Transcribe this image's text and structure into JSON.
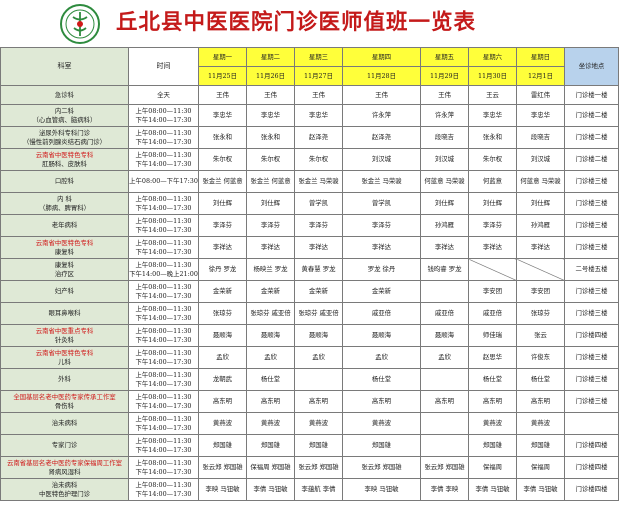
{
  "title": "丘北县中医医院门诊医师值班一览表",
  "header": {
    "dept_label": "科室",
    "time_label": "时间",
    "weekdays": [
      "星期一",
      "星期二",
      "星期三",
      "星期四",
      "星期五",
      "星期六",
      "星期日"
    ],
    "dates": [
      "11月25日",
      "11月26日",
      "11月27日",
      "11月28日",
      "11月29日",
      "11月30日",
      "12月1日"
    ],
    "location_label": "坐诊地点"
  },
  "rows": [
    {
      "dept": [
        "急诊科"
      ],
      "time": [
        "全天"
      ],
      "docs": [
        "王伟",
        "王伟",
        "王伟",
        "王伟",
        "王伟",
        "王云",
        "雷红伟"
      ],
      "loc": "门诊楼一楼"
    },
    {
      "dept": [
        "内二科",
        "（心血管病、脑病科）"
      ],
      "time": [
        "上午08:00—11:30",
        "下午14:00—17:30"
      ],
      "docs": [
        "李忠华",
        "李忠华",
        "李忠华",
        "许永萍",
        "许永萍",
        "李忠华",
        "李忠华"
      ],
      "loc": "门诊楼二楼"
    },
    {
      "dept": [
        "泌尿外科专科门诊",
        "（慢性前列腺炎结石病门诊）"
      ],
      "time": [
        "上午08:00—11:30",
        "下午14:00—17:30"
      ],
      "docs": [
        "张永和",
        "张永和",
        "赵泽尧",
        "赵泽尧",
        "段晓吉",
        "张永和",
        "段晓吉"
      ],
      "loc": "门诊楼二楼"
    },
    {
      "dept": [
        "云南省中医特色专科",
        "肛肠科、皮肤科"
      ],
      "red": [
        true,
        false
      ],
      "time": [
        "上午08:00—11:30",
        "下午14:00—17:30"
      ],
      "docs": [
        "朱尔权",
        "朱尔权",
        "朱尔权",
        "刘汉城",
        "刘汉城",
        "朱尔权",
        "刘汉城"
      ],
      "loc": "门诊楼二楼"
    },
    {
      "dept": [
        "口腔科"
      ],
      "time": [
        "上午08:00—下午17:30"
      ],
      "docs": [
        "张金兰 何蓝意",
        "张金兰 何蓝意",
        "张金兰 马荣骏",
        "张金兰 马荣骏",
        "何蓝意 马荣骏",
        "何蓝意",
        "何蓝意 马荣骏"
      ],
      "loc": "门诊楼三楼"
    },
    {
      "dept": [
        "内 科",
        "（肺病、脾胃科）"
      ],
      "time": [
        "上午08:00—11:30",
        "下午14:00—17:30"
      ],
      "docs": [
        "刘仕辉",
        "刘仕辉",
        "曾学凯",
        "曾学凯",
        "刘仕辉",
        "刘仕辉",
        "刘仕辉"
      ],
      "loc": "门诊楼三楼"
    },
    {
      "dept": [
        "老年病科"
      ],
      "time": [
        "上午08:00—11:30",
        "下午14:00—17:30"
      ],
      "docs": [
        "李泽芬",
        "李泽芬",
        "李泽芬",
        "李泽芬",
        "孙鸿雁",
        "李泽芬",
        "孙鸿雁"
      ],
      "loc": "门诊楼三楼"
    },
    {
      "dept": [
        "云南省中医特色专科",
        "康复科"
      ],
      "red": [
        true,
        false
      ],
      "time": [
        "上午08:00—11:30",
        "下午14:00—17:30"
      ],
      "docs": [
        "李祥达",
        "李祥达",
        "李祥达",
        "李祥达",
        "李祥达",
        "李祥达",
        "李祥达"
      ],
      "loc": "门诊楼三楼"
    },
    {
      "dept": [
        "康复科",
        "治疗区"
      ],
      "time": [
        "上午08:00—11:30",
        "下午14:00—晚上21:00"
      ],
      "docs": [
        "徐丹 罗龙",
        "杨映兰 罗龙",
        "黄春慧 罗龙",
        "罗龙 徐丹",
        "钱昀睿 罗龙",
        "",
        ""
      ],
      "diag": [
        false,
        false,
        false,
        false,
        false,
        true,
        true
      ],
      "loc": "二号楼五楼"
    },
    {
      "dept": [
        "妇产科"
      ],
      "time": [
        "上午08:00—11:30",
        "下午14:00—17:30"
      ],
      "docs": [
        "金荣新",
        "金荣新",
        "金荣新",
        "金荣新",
        "",
        "李安团",
        "李安团"
      ],
      "loc": "门诊楼三楼"
    },
    {
      "dept": [
        "眼耳鼻喉科"
      ],
      "time": [
        "上午08:00—11:30",
        "下午14:00—17:30"
      ],
      "docs": [
        "张琼芬",
        "张琼芬 戚亚倍",
        "张琼芬 戚亚倍",
        "戚亚倍",
        "戚亚倍",
        "戚亚倍",
        "张琼芬"
      ],
      "loc": "门诊楼三楼"
    },
    {
      "dept": [
        "云南省中医重点专科",
        "针灸科"
      ],
      "red": [
        true,
        false
      ],
      "time": [
        "上午08:00—11:30",
        "下午14:00—17:30"
      ],
      "docs": [
        "聂顺海",
        "聂顺海",
        "聂顺海",
        "聂顺海",
        "聂顺海",
        "师佳瑞",
        "张云"
      ],
      "loc": "门诊楼四楼"
    },
    {
      "dept": [
        "云南省中医特色专科",
        "儿科"
      ],
      "red": [
        true,
        false
      ],
      "time": [
        "上午08:00—11:30",
        "下午14:00—17:30"
      ],
      "docs": [
        "孟欣",
        "孟欣",
        "孟欣",
        "孟欣",
        "孟欣",
        "赵思华",
        "许俊东"
      ],
      "loc": "门诊楼三楼"
    },
    {
      "dept": [
        "外科"
      ],
      "time": [
        "上午08:00—11:30",
        "下午14:00—17:30"
      ],
      "docs": [
        "龙朝武",
        "杨仕堂",
        "",
        "杨仕堂",
        "",
        "杨仕堂",
        "杨仕堂"
      ],
      "loc": "门诊楼三楼"
    },
    {
      "dept": [
        "全国基层名老中医药专家传承工作室",
        "骨伤科"
      ],
      "red": [
        true,
        false
      ],
      "time": [
        "上午08:00—11:30",
        "下午14:00—17:30"
      ],
      "docs": [
        "高东明",
        "高东明",
        "高东明",
        "高东明",
        "高东明",
        "高东明",
        "高东明"
      ],
      "loc": "门诊楼三楼"
    },
    {
      "dept": [
        "治未病科"
      ],
      "time": [
        "上午08:00—11:30",
        "下午14:00—17:30"
      ],
      "docs": [
        "黄燕波",
        "黄燕波",
        "黄燕波",
        "黄燕波",
        "",
        "黄燕波",
        "黄燕波"
      ],
      "loc": ""
    },
    {
      "dept": [
        "专家门诊"
      ],
      "time": [
        "上午08:00—11:30",
        "下午14:00—17:30"
      ],
      "docs": [
        "郑国雄",
        "郑国雄",
        "郑国雄",
        "郑国雄",
        "",
        "郑国雄",
        "郑国雄"
      ],
      "loc": "门诊楼四楼"
    },
    {
      "dept": [
        "云南省基层名老中医药专家保福周工作室",
        "肾病风湿科"
      ],
      "red": [
        true,
        false
      ],
      "time": [
        "上午08:00—11:30",
        "下午14:00—17:30"
      ],
      "docs": [
        "张云郑 郑国雄",
        "保福周 郑国雄",
        "张云郑 郑国雄",
        "张云郑 郑国雄",
        "张云郑 郑国雄",
        "保福周",
        "保福周"
      ],
      "loc": "门诊楼四楼"
    },
    {
      "dept": [
        "治未病科",
        "中医特色护理门诊"
      ],
      "time": [
        "上午08:00—11:30",
        "下午14:00—17:30"
      ],
      "docs": [
        "李映 马钮敏",
        "李倩 马钮敏",
        "李蕴航 李倩",
        "李映 马钮敏",
        "李倩 李映",
        "李倩 马钮敏",
        "李倩 马钮敏"
      ],
      "loc": "门诊楼四楼"
    }
  ],
  "colors": {
    "title_red": "#c41a1a",
    "header_yellow": "#ffff3a",
    "loc_blue": "#b8d2ec",
    "dept_green": "#dfe9d6"
  }
}
